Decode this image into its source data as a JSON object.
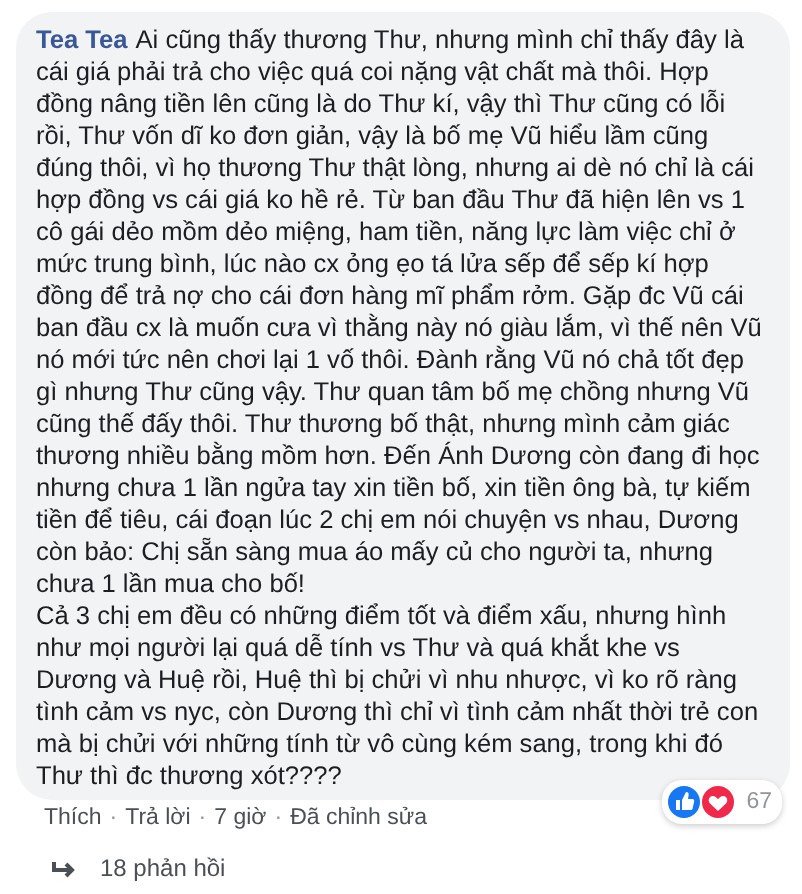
{
  "comment": {
    "author": "Tea Tea",
    "paragraphs": [
      "Ai cũng thấy thương Thư, nhưng mình chỉ thấy đây là cái giá phải trả cho việc quá coi nặng vật chất mà thôi. Hợp đồng nâng tiền lên cũng là do Thư kí, vậy thì Thư cũng có lỗi rồi, Thư vốn dĩ ko đơn giản, vậy là bố mẹ Vũ hiểu lầm cũng đúng thôi, vì họ thương Thư thật lòng, nhưng ai dè nó chỉ là cái hợp đồng vs cái giá ko hề rẻ. Từ ban đầu Thư đã hiện lên vs 1 cô gái dẻo mồm dẻo miệng, ham tiền, năng lực làm việc chỉ ở mức trung bình, lúc nào cx ỏng ẹo tá lửa sếp để sếp kí hợp đồng để trả nợ cho cái đơn hàng mĩ phẩm rởm. Gặp đc Vũ cái ban đầu cx là muốn cưa vì thằng này nó giàu lắm, vì thế nên Vũ nó mới tức nên chơi lại 1 vố thôi. Đành rằng Vũ nó chả tốt đẹp gì nhưng Thư cũng vậy. Thư quan tâm bố mẹ chồng nhưng Vũ cũng thế đấy thôi. Thư thương bố thật, nhưng mình cảm giác thương nhiều bằng mồm hơn. Đến Ánh Dương còn đang đi học nhưng chưa 1 lần ngửa tay xin tiền bố, xin tiền ông bà, tự kiếm tiền để tiêu, cái đoạn lúc 2 chị em nói chuyện vs nhau, Dương còn bảo: Chị sẵn sàng mua áo mấy củ cho người ta, nhưng chưa 1 lần mua cho bố!",
      "Cả 3 chị em đều có những điểm tốt và điểm xấu, nhưng hình như mọi người lại quá dễ tính vs Thư và quá khắt khe vs Dương và Huệ rồi, Huệ thì bị chửi vì nhu nhược, vì ko rõ ràng tình cảm vs nyc, còn Dương thì chỉ vì tình cảm nhất thời trẻ con mà bị chửi với những tính từ vô cùng kém sang, trong khi đó Thư thì đc thương xót????"
    ],
    "reaction_count": "67",
    "actions": [
      "Thích",
      "Trả lời",
      "7 giờ",
      "Đã chỉnh sửa"
    ],
    "action_separator": "·",
    "replies": "18 phản hồi"
  }
}
